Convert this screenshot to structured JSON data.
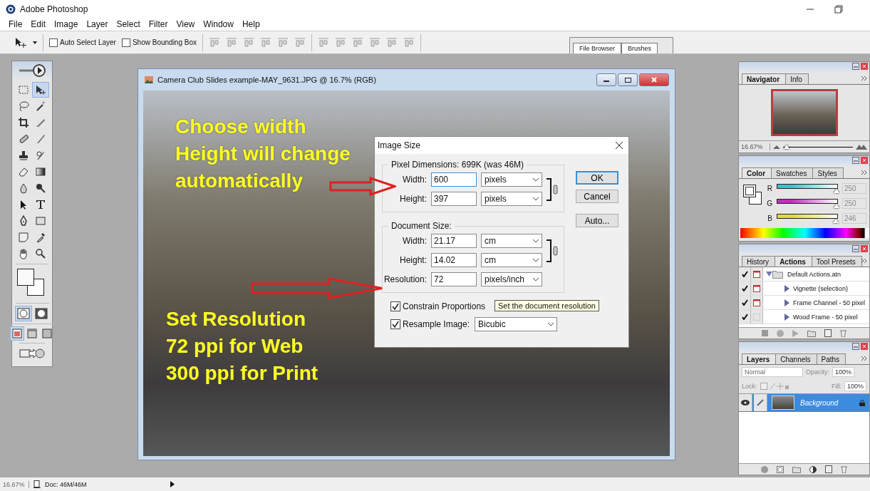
{
  "app": {
    "title": "Adobe Photoshop"
  },
  "menu": [
    "File",
    "Edit",
    "Image",
    "Layer",
    "Select",
    "Filter",
    "View",
    "Window",
    "Help"
  ],
  "options_bar": {
    "checkboxes": [
      {
        "label": "Auto Select Layer",
        "checked": false
      },
      {
        "label": "Show Bounding Box",
        "checked": false
      }
    ]
  },
  "palette_well": {
    "tabs": [
      "File Browser",
      "Brushes"
    ]
  },
  "toolbox": {
    "tools": [
      {
        "kind": "marquee",
        "selected": false
      },
      {
        "kind": "move",
        "selected": true
      },
      {
        "kind": "lasso",
        "selected": false
      },
      {
        "kind": "wand",
        "selected": false
      },
      {
        "kind": "crop",
        "selected": false
      },
      {
        "kind": "slice",
        "selected": false
      },
      {
        "kind": "heal",
        "selected": false
      },
      {
        "kind": "brush",
        "selected": false
      },
      {
        "kind": "stamp",
        "selected": false
      },
      {
        "kind": "historybrush",
        "selected": false
      },
      {
        "kind": "eraser",
        "selected": false
      },
      {
        "kind": "gradient",
        "selected": false
      },
      {
        "kind": "blur",
        "selected": false
      },
      {
        "kind": "burn",
        "selected": false
      },
      {
        "kind": "pathselect",
        "selected": false
      },
      {
        "kind": "type",
        "selected": false
      },
      {
        "kind": "pen",
        "selected": false
      },
      {
        "kind": "shape",
        "selected": false
      },
      {
        "kind": "notes",
        "selected": false
      },
      {
        "kind": "eyedropper",
        "selected": false
      },
      {
        "kind": "hand",
        "selected": false
      },
      {
        "kind": "zoom",
        "selected": false
      }
    ],
    "mask_modes": [
      {
        "kind": "standard",
        "selected": true
      },
      {
        "kind": "quickmask",
        "selected": false
      }
    ],
    "screen_modes": [
      {
        "kind": "window",
        "selected": true
      },
      {
        "kind": "menu",
        "selected": false
      },
      {
        "kind": "full",
        "selected": false
      }
    ]
  },
  "document": {
    "title": "Camera Club Slides example-MAY_9631.JPG @ 16.7% (RGB)",
    "annotations": [
      {
        "text": "Choose width\nHeight will change\nautomatically"
      },
      {
        "text": "Set Resolution\n72 ppi for Web\n300 ppi for Print"
      }
    ]
  },
  "dialog": {
    "title": "Image Size",
    "groups": [
      {
        "legend": "Pixel Dimensions:  699K (was 46M)",
        "rows": [
          {
            "label": "Width:",
            "value": "600",
            "unit": "pixels",
            "focused": true
          },
          {
            "label": "Height:",
            "value": "397",
            "unit": "pixels",
            "focused": false
          }
        ]
      },
      {
        "legend": "Document Size:",
        "rows": [
          {
            "label": "Width:",
            "value": "21.17",
            "unit": "cm",
            "focused": false
          },
          {
            "label": "Height:",
            "value": "14.02",
            "unit": "cm",
            "focused": false
          },
          {
            "label": "Resolution:",
            "value": "72",
            "unit": "pixels/inch",
            "focused": false
          }
        ]
      }
    ],
    "options": [
      {
        "label": "Constrain Proportions",
        "checked": true
      },
      {
        "label": "Resample Image:",
        "checked": true,
        "value": "Bicubic"
      }
    ],
    "buttons": [
      {
        "label": "OK",
        "default": true
      },
      {
        "label": "Cancel",
        "default": false
      },
      {
        "label": "Auto...",
        "default": false
      }
    ],
    "tooltip": "Set the document resolution"
  },
  "navigator": {
    "tabs": [
      {
        "label": "Navigator",
        "selected": true
      },
      {
        "label": "Info",
        "selected": false
      }
    ],
    "zoom": "16.67%",
    "level": 0.05
  },
  "color": {
    "tabs": [
      {
        "label": "Color",
        "selected": true
      },
      {
        "label": "Swatches",
        "selected": false
      },
      {
        "label": "Styles",
        "selected": false
      }
    ],
    "channels": [
      {
        "name": "R",
        "value": "250",
        "level": 0.98,
        "color": "#33c8c8"
      },
      {
        "name": "G",
        "value": "250",
        "level": 0.98,
        "color": "#c030c0"
      },
      {
        "name": "B",
        "value": "246",
        "level": 0.965,
        "color": "#e0dc30"
      }
    ]
  },
  "actions": {
    "tabs": [
      {
        "label": "History",
        "selected": false
      },
      {
        "label": "Actions",
        "selected": true
      },
      {
        "label": "Tool Presets",
        "selected": false
      }
    ],
    "items": [
      {
        "name": "Default Actions.atn",
        "checked": true,
        "dialog": true,
        "expanded": true,
        "children": [
          {
            "name": "Vignette (selection)",
            "checked": true,
            "dialog": true
          },
          {
            "name": "Frame Channel - 50 pixel",
            "checked": true,
            "dialog": true
          },
          {
            "name": "Wood Frame - 50 pixel",
            "checked": true,
            "dialog": false
          }
        ]
      }
    ]
  },
  "layers": {
    "tabs": [
      {
        "label": "Layers",
        "selected": true
      },
      {
        "label": "Channels",
        "selected": false
      },
      {
        "label": "Paths",
        "selected": false
      }
    ],
    "blend_mode": "Normal",
    "opacity_label": "Opacity:",
    "opacity": "100%",
    "lock_label": "Lock:",
    "fill_label": "Fill:",
    "fill": "100%",
    "items": [
      {
        "name": "Background",
        "visible": true,
        "selected": true,
        "locked": true
      }
    ]
  },
  "status_bar": {
    "zoom": "16.67%",
    "doc": "Doc: 46M/46M"
  }
}
